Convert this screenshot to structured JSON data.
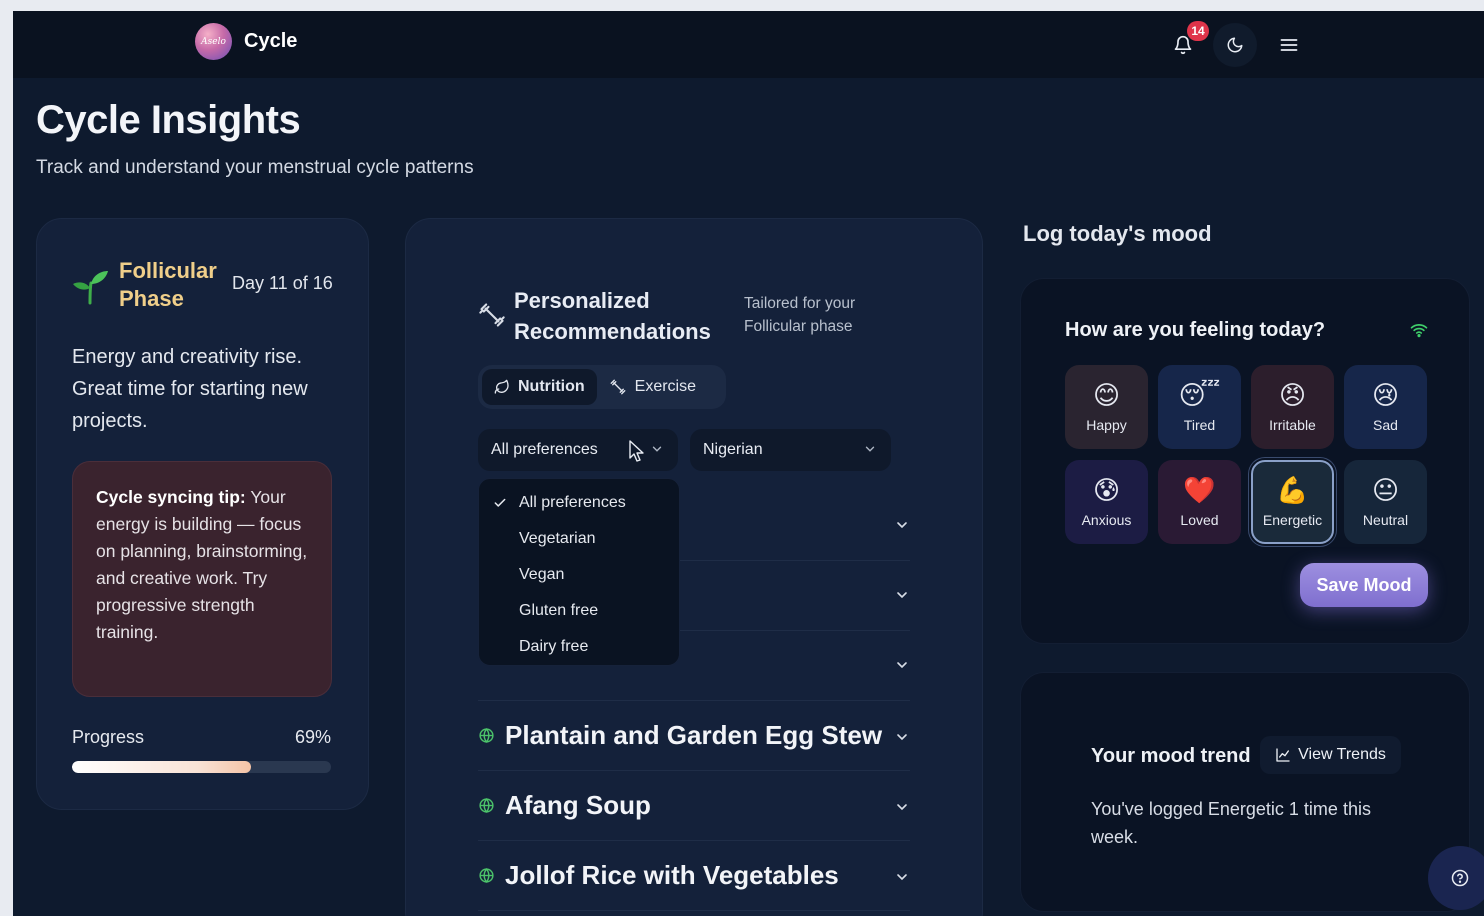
{
  "brand": {
    "logo_text": "Aselo",
    "name": "Cycle"
  },
  "nav": {
    "notification_count": "14"
  },
  "page": {
    "title": "Cycle Insights",
    "subtitle": "Track and understand your menstrual cycle patterns"
  },
  "phase": {
    "name": "Follicular Phase",
    "day": "Day 11 of 16",
    "description": "Energy and creativity rise. Great time for starting new projects.",
    "tip_label": "Cycle syncing tip:",
    "tip_text": "Your energy is building — focus on planning, brainstorming, and creative work. Try progressive strength training.",
    "progress_label": "Progress",
    "progress_pct_text": "69%",
    "progress_value": 0.69
  },
  "recommendations": {
    "title": "Personalized Recommendations",
    "tagline": "Tailored for your Follicular phase",
    "tabs": [
      {
        "label": "Nutrition",
        "active": true
      },
      {
        "label": "Exercise",
        "active": false
      }
    ],
    "preference_select": "All preferences",
    "cuisine_select": "Nigerian",
    "preference_options": [
      "All preferences",
      "Vegetarian",
      "Vegan",
      "Gluten free",
      "Dairy free"
    ],
    "selected_option": "All preferences",
    "recipes": [
      "Plantain and Garden Egg Stew",
      "Afang Soup",
      "Jollof Rice with Vegetables"
    ]
  },
  "mood": {
    "heading": "Log today's mood",
    "question": "How are you feeling today?",
    "options": [
      {
        "emoji": "😊",
        "label": "Happy",
        "bg": "#2a2430"
      },
      {
        "emoji": "😴",
        "label": "Tired",
        "bg": "#16264a"
      },
      {
        "emoji": "😠",
        "label": "Irritable",
        "bg": "#2c1e2c"
      },
      {
        "emoji": "😢",
        "label": "Sad",
        "bg": "#16264a"
      },
      {
        "emoji": "😰",
        "label": "Anxious",
        "bg": "#1c1c44"
      },
      {
        "emoji": "❤️",
        "label": "Loved",
        "bg": "#2a1a34"
      },
      {
        "emoji": "💪",
        "label": "Energetic",
        "bg": "#1a2a3a"
      },
      {
        "emoji": "😐",
        "label": "Neutral",
        "bg": "#16263a"
      }
    ],
    "selected": "Energetic",
    "save_label": "Save Mood"
  },
  "trend": {
    "title": "Your mood trend",
    "button_label": "View Trends",
    "text": "You've logged Energetic 1 time this week."
  },
  "colors": {
    "accent_phase": "#f0cf8a",
    "save_button": "#8f80d8",
    "badge": "#e0344a"
  }
}
